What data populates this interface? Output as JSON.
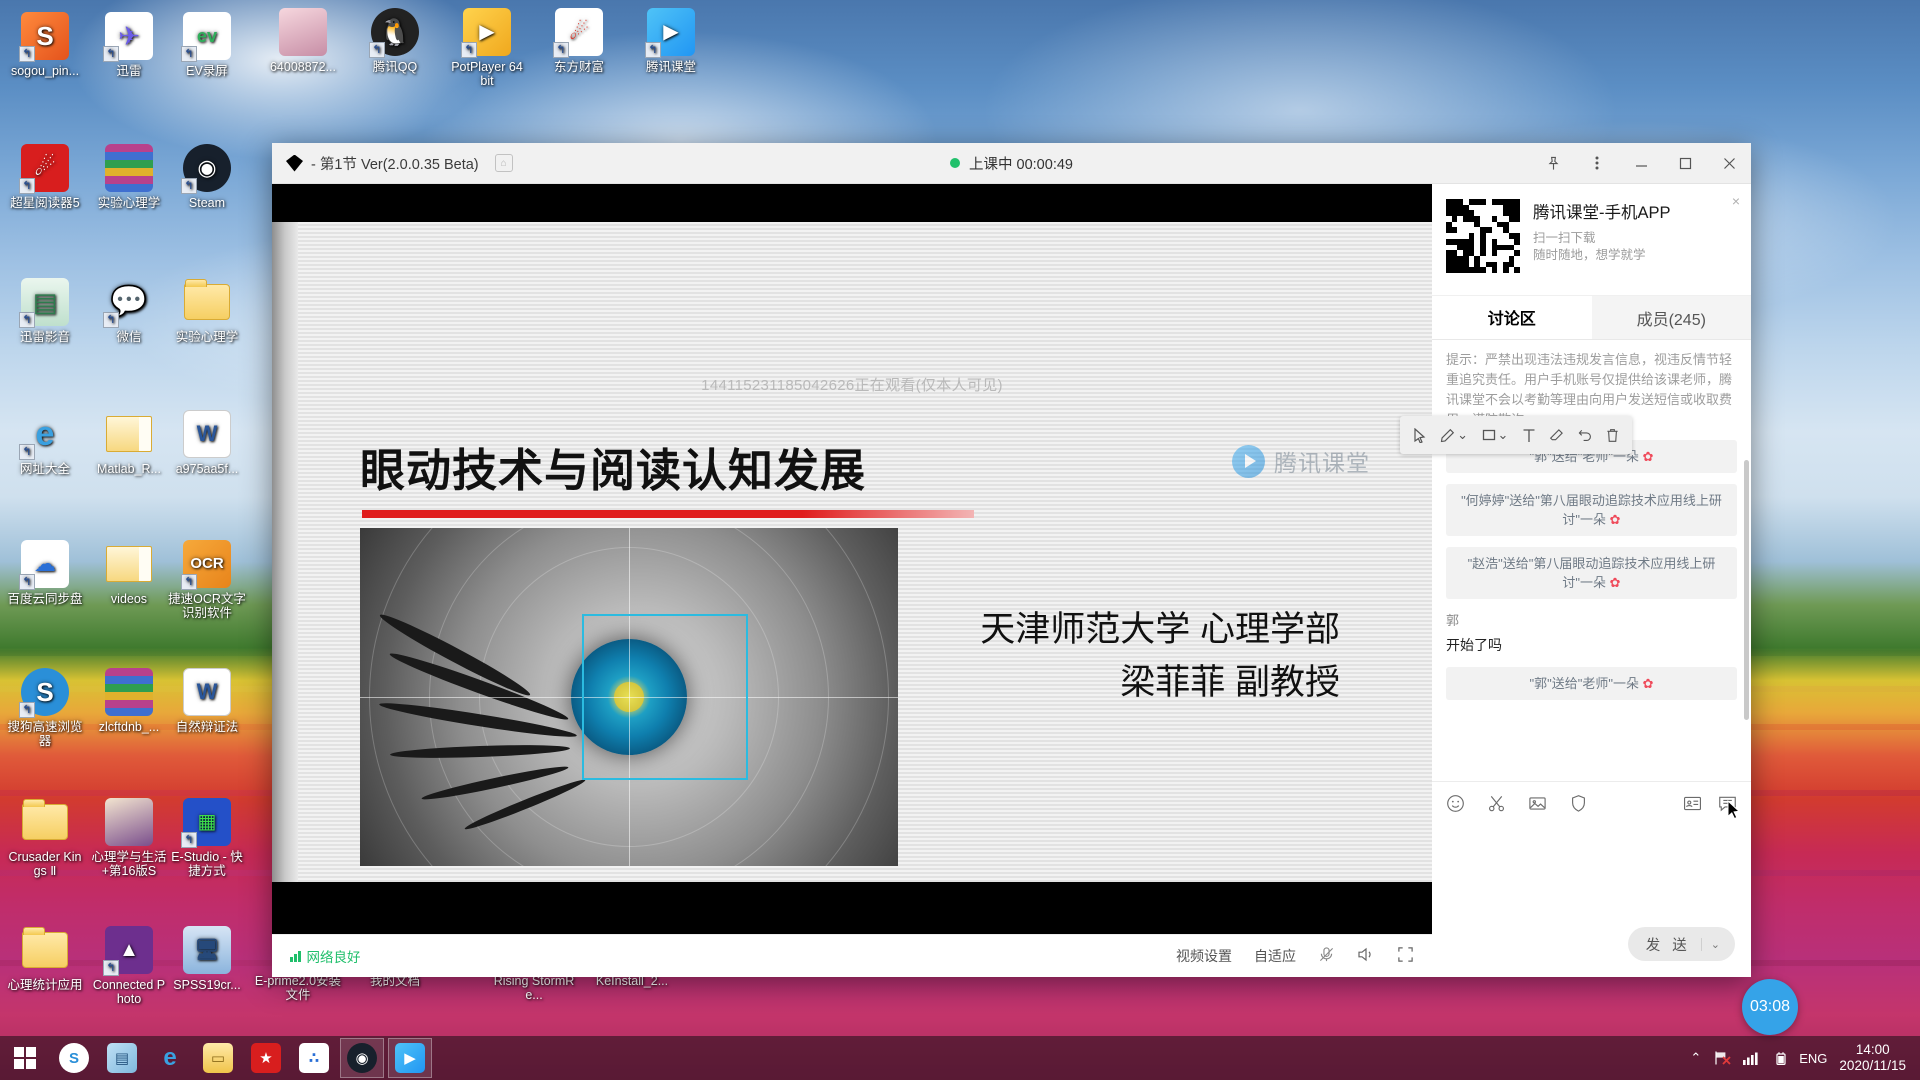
{
  "desktop": {
    "icons": [
      {
        "label": "sogou_pin...",
        "type": "app-sogou-pinyin"
      },
      {
        "label": "迅雷",
        "type": "app-thunder"
      },
      {
        "label": "EV录屏",
        "type": "app-evcapture"
      },
      {
        "label": "64008872...",
        "type": "image-file"
      },
      {
        "label": "腾讯QQ",
        "type": "app-qq"
      },
      {
        "label": "PotPlayer 64 bit",
        "type": "app-potplayer"
      },
      {
        "label": "东方财富",
        "type": "app-eastmoney"
      },
      {
        "label": "腾讯课堂",
        "type": "app-ketang"
      },
      {
        "label": "超星阅读器5",
        "type": "app-chaoxing"
      },
      {
        "label": "实验心理学",
        "type": "archive-rar"
      },
      {
        "label": "Steam",
        "type": "app-steam"
      },
      {
        "label": "迅雷影音",
        "type": "app-thunder-player"
      },
      {
        "label": "微信",
        "type": "app-wechat"
      },
      {
        "label": "实验心理学",
        "type": "folder"
      },
      {
        "label": "网址大全",
        "type": "app-ie-hao123"
      },
      {
        "label": "Matlab_R...",
        "type": "folder-open"
      },
      {
        "label": "a975aa5f...",
        "type": "doc-word"
      },
      {
        "label": "百度云同步盘",
        "type": "app-baiduyun"
      },
      {
        "label": "videos",
        "type": "folder-open"
      },
      {
        "label": "捷速OCR文字识别软件",
        "type": "app-ocr"
      },
      {
        "label": "搜狗高速浏览器",
        "type": "app-sogou-browser"
      },
      {
        "label": "zlcftdnb_...",
        "type": "archive-rar"
      },
      {
        "label": "自然辩证法",
        "type": "doc-word"
      },
      {
        "label": "Crusader Kings Ⅱ",
        "type": "folder"
      },
      {
        "label": "心理学与生活+第16版S",
        "type": "book-cover"
      },
      {
        "label": "E-Studio - 快捷方式",
        "type": "app-estudio"
      },
      {
        "label": "心理统计应用",
        "type": "folder"
      },
      {
        "label": "Connected Photo",
        "type": "app-photo"
      },
      {
        "label": "SPSS19cr...",
        "type": "app-spss"
      },
      {
        "label": "E-prime2.0安装文件",
        "type": "folder"
      },
      {
        "label": "我的文档",
        "type": "folder"
      },
      {
        "label": "Rising StormRe...",
        "type": "folder"
      },
      {
        "label": "KeInstall_2...",
        "type": "folder"
      }
    ]
  },
  "window": {
    "title": "- 第1节 Ver(2.0.0.35 Beta)",
    "home_icon": "home-icon",
    "status_text": "上课中 00:00:49",
    "status_dot_color": "#21c06b",
    "controls": {
      "pin": "pin-icon",
      "more": "more-vertical-icon",
      "minimize": "minimize-icon",
      "maximize": "maximize-icon",
      "close": "close-icon"
    }
  },
  "slide": {
    "watch_note": "144115231185042626正在观看(仅本人可见)",
    "title": "眼动技术与阅读认知发展",
    "affiliation": "天津师范大学 心理学部",
    "presenter": "梁菲菲 副教授",
    "watermark": "腾讯课堂"
  },
  "annotation_toolbar": {
    "tools": [
      {
        "name": "select-cursor-tool",
        "glyph": "cursor"
      },
      {
        "name": "pen-tool",
        "glyph": "pen",
        "has_dropdown": true
      },
      {
        "name": "shape-tool",
        "glyph": "rectangle",
        "has_dropdown": true
      },
      {
        "name": "text-tool",
        "glyph": "text"
      },
      {
        "name": "eraser-tool",
        "glyph": "eraser"
      },
      {
        "name": "undo-tool",
        "glyph": "undo"
      },
      {
        "name": "delete-tool",
        "glyph": "trash"
      }
    ]
  },
  "player_bar": {
    "network_status": "网络良好",
    "video_settings": "视频设置",
    "quality": "自适应",
    "mic": "microphone-muted-icon",
    "volume": "speaker-icon",
    "fullscreen": "fullscreen-icon"
  },
  "side_panel": {
    "promo": {
      "title": "腾讯课堂-手机APP",
      "line1": "扫一扫下载",
      "line2": "随时随地，想学就学",
      "close": "×"
    },
    "tabs": [
      {
        "label": "讨论区",
        "active": true
      },
      {
        "label": "成员(245)",
        "active": false
      }
    ],
    "notice": "提示：严禁出现违法违规发言信息，视违反情节轻重追究责任。用户手机账号仅提供给该课老师，腾讯课堂不会以考勤等理由向用户发送短信或收取费用，谨防欺诈。",
    "messages": [
      {
        "kind": "gift",
        "text": "\"郭\"送给\"老师\"一朵",
        "flower": "✿"
      },
      {
        "kind": "gift",
        "text": "\"何婷婷\"送给\"第八届眼动追踪技术应用线上研讨\"一朵",
        "flower": "✿"
      },
      {
        "kind": "gift",
        "text": "\"赵浩\"送给\"第八届眼动追踪技术应用线上研讨\"一朵",
        "flower": "✿"
      },
      {
        "kind": "user",
        "name": "郭",
        "text": "开始了吗"
      },
      {
        "kind": "gift",
        "text": "\"郭\"送给\"老师\"一朵",
        "flower": "✿"
      }
    ],
    "composer": {
      "icons_left": [
        "emoji-icon",
        "scissors-icon",
        "image-icon",
        "shield-icon"
      ],
      "icons_right": [
        "card-icon",
        "quick-reply-icon"
      ],
      "send_label": "发 送",
      "send_caret": "⌄",
      "input_value": "",
      "input_placeholder": ""
    }
  },
  "floating_timer": "03:08",
  "taskbar": {
    "start": "windows-start-icon",
    "apps": [
      {
        "name": "sogou-browser",
        "label": "S"
      },
      {
        "name": "screen-tool",
        "label": "▤"
      },
      {
        "name": "internet-explorer",
        "label": "e"
      },
      {
        "name": "file-explorer",
        "label": "▭"
      },
      {
        "name": "chaoxing-reader",
        "label": "★"
      },
      {
        "name": "baidu-yun",
        "label": "∴"
      },
      {
        "name": "steam",
        "label": "◉"
      },
      {
        "name": "ketang",
        "label": "▶"
      }
    ],
    "tray": {
      "show_hidden": "chevron-up-icon",
      "network_flag": "network-error-icon",
      "signal": "signal-icon",
      "battery": "battery-charging-icon",
      "language": "ENG",
      "time": "14:00",
      "date": "2020/11/15"
    }
  }
}
